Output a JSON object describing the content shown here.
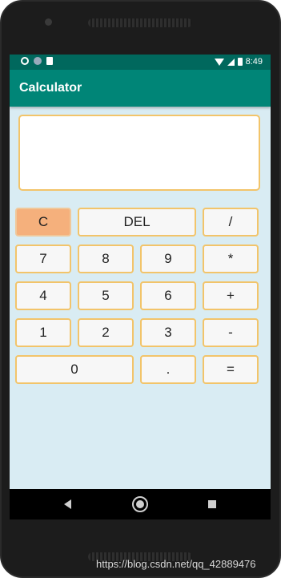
{
  "status_bar": {
    "time": "8:49",
    "icons_left": [
      "gear-icon",
      "circle-icon",
      "sd-card-icon"
    ],
    "icons_right": [
      "wifi-icon",
      "signal-icon",
      "battery-icon"
    ]
  },
  "app_bar": {
    "title": "Calculator"
  },
  "display": {
    "value": ""
  },
  "buttons": {
    "clear": "C",
    "delete": "DEL",
    "divide": "/",
    "seven": "7",
    "eight": "8",
    "nine": "9",
    "multiply": "*",
    "four": "4",
    "five": "5",
    "six": "6",
    "plus": "+",
    "one": "1",
    "two": "2",
    "three": "3",
    "minus": "-",
    "zero": "0",
    "dot": ".",
    "equals": "="
  },
  "nav_bar": {
    "icons": [
      "back-icon",
      "home-icon",
      "recent-apps-icon"
    ]
  },
  "watermark": {
    "text": "https://blog.csdn.net/qq_42889476"
  },
  "colors": {
    "status_bar": "#00685d",
    "app_bar": "#008577",
    "background": "#d9ecf3",
    "button_border": "#f2c46a",
    "clear_button": "#f5b07c"
  }
}
